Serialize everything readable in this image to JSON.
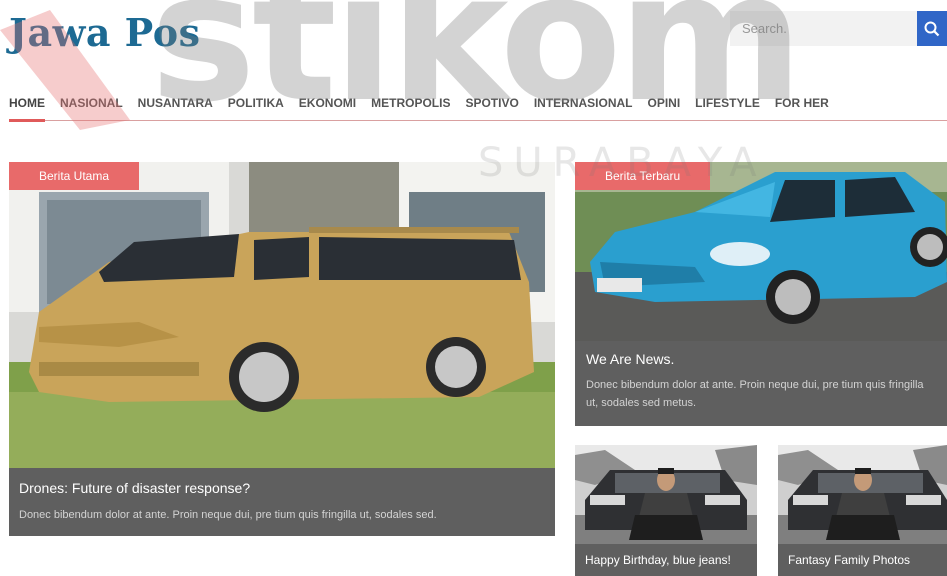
{
  "header": {
    "logo_text": "Jawa Pos",
    "search_placeholder": "Search.",
    "search_icon": "search-icon"
  },
  "watermark": {
    "main": "stikom",
    "sub": "SURABAYA"
  },
  "nav": {
    "items": [
      {
        "label": "HOME"
      },
      {
        "label": "NASIONAL"
      },
      {
        "label": "NUSANTARA"
      },
      {
        "label": "POLITIKA"
      },
      {
        "label": "EKONOMI"
      },
      {
        "label": "METROPOLIS"
      },
      {
        "label": "SPOTIVO"
      },
      {
        "label": "INTERNASIONAL"
      },
      {
        "label": "OPINI"
      },
      {
        "label": "LIFESTYLE"
      },
      {
        "label": "FOR HER"
      }
    ]
  },
  "featured": {
    "tag": "Berita Utama",
    "title": "Drones: Future of disaster response?",
    "excerpt": "Donec bibendum dolor at ante. Proin neque dui, pre tium quis fringilla ut, sodales sed."
  },
  "latest": {
    "tag": "Berita Terbaru",
    "title": "We Are News.",
    "excerpt": "Donec bibendum dolor at ante. Proin neque dui, pre tium quis fringilla ut, sodales sed metus."
  },
  "small_posts": [
    {
      "title": "Happy Birthday, blue jeans!"
    },
    {
      "title": "Fantasy Family Photos"
    }
  ],
  "colors": {
    "logo": "#1d6a93",
    "tag_bg": "#e86a6a",
    "caption_bg": "#5f5f5f",
    "search_button": "#3066c7"
  }
}
